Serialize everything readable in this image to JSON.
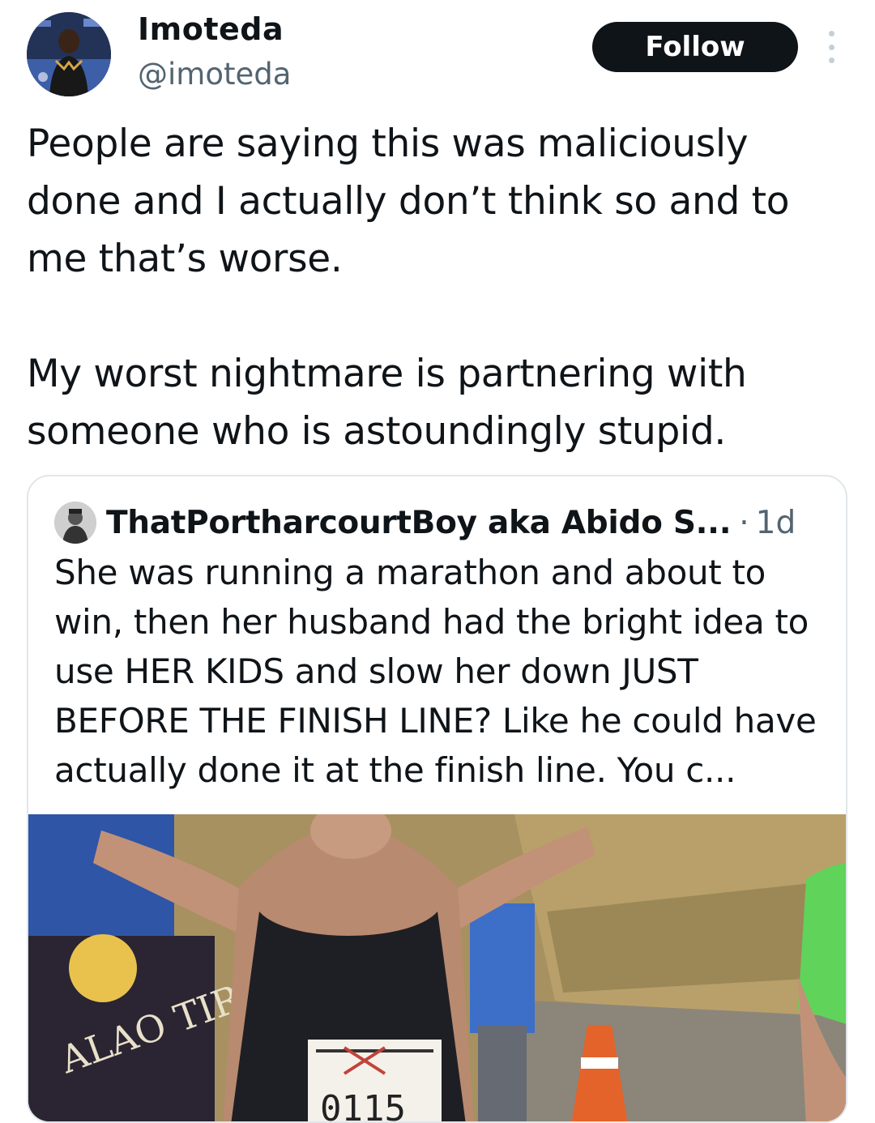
{
  "author": {
    "name": "Imoteda",
    "handle": "@imoteda",
    "avatar": "profile-photo"
  },
  "follow_label": "Follow",
  "more_icon": "more-vertical-icon",
  "tweet_text": "People are saying this was maliciously done and I actually don’t think so and to me that’s worse.\n\nMy worst nightmare is partnering with someone who is astoundingly stupid.",
  "quoted": {
    "name": "ThatPortharcourtBoy aka Abido S...",
    "separator": "·",
    "time": "1d",
    "text": "She was running a marathon and about to win, then her husband had the bright idea to use HER KIDS and slow her down JUST BEFORE THE FINISH LINE? Like he could have actually done it at the finish line. You c...",
    "media": {
      "type": "video-thumbnail",
      "banner_text": "ALAO TIRAS",
      "bib_number": "0115"
    }
  },
  "colors": {
    "text": "#0f1419",
    "secondary": "#536471",
    "follow_bg": "#0f1419",
    "border": "#e1e6ea"
  }
}
